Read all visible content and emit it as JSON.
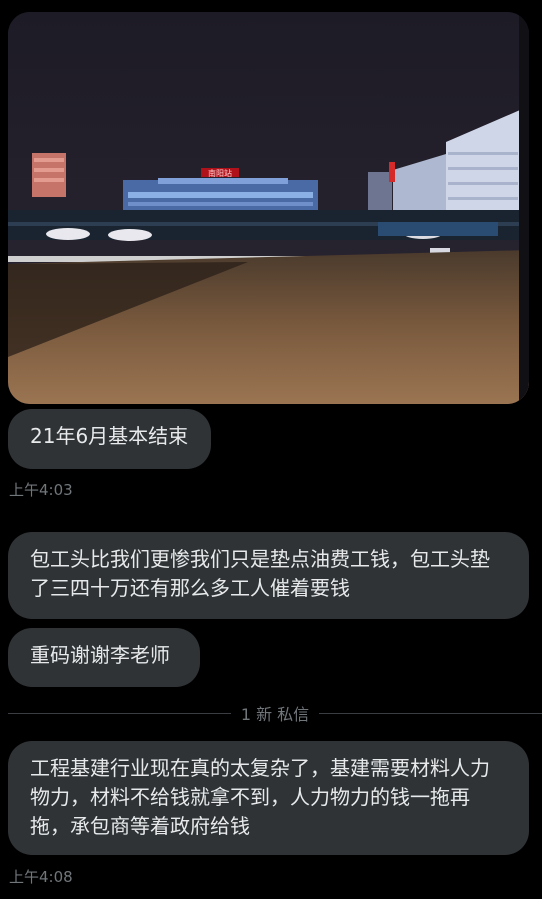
{
  "messages": [
    {
      "text": "21年6月基本结束"
    },
    {
      "text": "包工头比我们更惨我们只是垫点油费工钱，包工头垫了三四十万还有那么多工人催着要钱"
    },
    {
      "text": "重码谢谢李老师"
    },
    {
      "text": "工程基建行业现在真的太复杂了，基建需要材料人力物力，材料不给钱就拿不到，人力物力的钱一拖再拖，承包商等着政府给钱"
    }
  ],
  "timestamps": [
    "上午4:03",
    "上午4:08"
  ],
  "divider": {
    "label": "1 新 私信"
  },
  "photo": {
    "station_sign": "南阳站"
  }
}
